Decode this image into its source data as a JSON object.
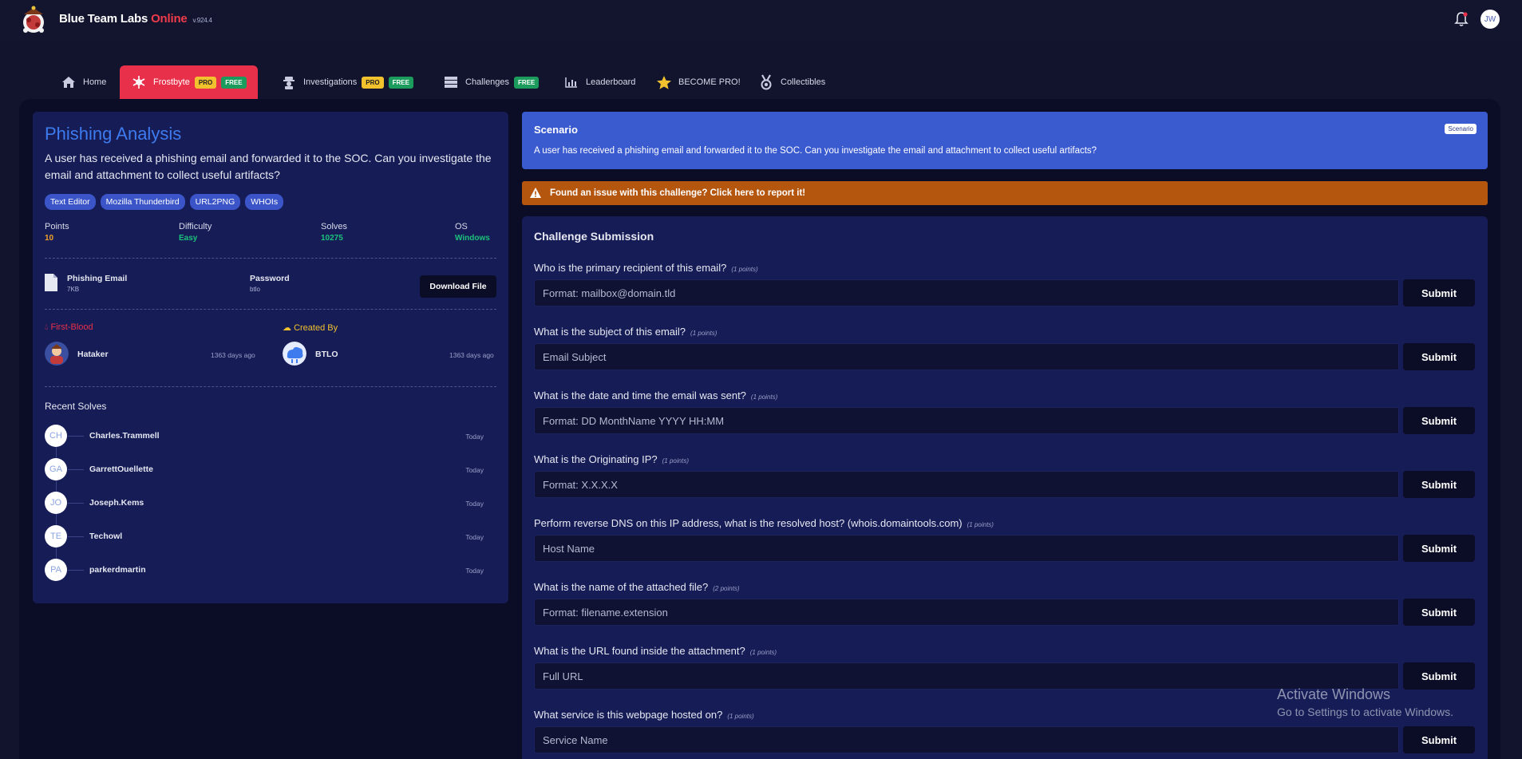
{
  "brand": {
    "name": "Blue Team Labs",
    "online": "Online",
    "version": "v.924.4"
  },
  "user": {
    "initials": "JW"
  },
  "nav": [
    {
      "label": "Home"
    },
    {
      "label": "Frostbyte",
      "pro": "PRO",
      "free": "FREE"
    },
    {
      "label": "Investigations",
      "pro": "PRO",
      "free": "FREE"
    },
    {
      "label": "Challenges",
      "free": "FREE"
    },
    {
      "label": "Leaderboard"
    },
    {
      "label": "BECOME PRO!"
    },
    {
      "label": "Collectibles"
    }
  ],
  "challenge": {
    "title": "Phishing Analysis",
    "description": "A user has received a phishing email and forwarded it to the SOC. Can you investigate the email and attachment to collect useful artifacts?",
    "tags": [
      "Text Editor",
      "Mozilla Thunderbird",
      "URL2PNG",
      "WHOIs"
    ],
    "stats": {
      "points_label": "Points",
      "points": "10",
      "difficulty_label": "Difficulty",
      "difficulty": "Easy",
      "solves_label": "Solves",
      "solves": "10275",
      "os_label": "OS",
      "os": "Windows"
    },
    "file": {
      "name": "Phishing Email",
      "size": "7KB",
      "password_label": "Password",
      "password": "btlo",
      "download_label": "Download File"
    },
    "first_blood": {
      "label": "First-Blood",
      "user": "Hataker",
      "ago": "1363 days ago"
    },
    "created_by": {
      "label": "Created By",
      "user": "BTLO",
      "ago": "1363 days ago"
    },
    "recent_solves_title": "Recent Solves",
    "recent_solves": [
      {
        "initials": "CH",
        "user": "Charles.Trammell",
        "when": "Today"
      },
      {
        "initials": "GA",
        "user": "GarrettOuellette",
        "when": "Today"
      },
      {
        "initials": "JO",
        "user": "Joseph.Kems",
        "when": "Today"
      },
      {
        "initials": "TE",
        "user": "Techowl",
        "when": "Today"
      },
      {
        "initials": "PA",
        "user": "parkerdmartin",
        "when": "Today"
      }
    ]
  },
  "scenario": {
    "title": "Scenario",
    "badge": "Scenario",
    "text": "A user has received a phishing email and forwarded it to the SOC. Can you investigate the email and attachment to collect useful artifacts?"
  },
  "report": {
    "text": "Found an issue with this challenge? Click here to report it!"
  },
  "submission": {
    "title": "Challenge Submission",
    "submit_label": "Submit",
    "questions": [
      {
        "question": "Who is the primary recipient of this email?",
        "points": "(1 points)",
        "placeholder": "Format: mailbox@domain.tld"
      },
      {
        "question": "What is the subject of this email?",
        "points": "(1 points)",
        "placeholder": "Email Subject"
      },
      {
        "question": "What is the date and time the email was sent?",
        "points": "(1 points)",
        "placeholder": "Format: DD MonthName YYYY HH:MM"
      },
      {
        "question": "What is the Originating IP?",
        "points": "(1 points)",
        "placeholder": "Format: X.X.X.X"
      },
      {
        "question": "Perform reverse DNS on this IP address, what is the resolved host? (whois.domaintools.com)",
        "points": "(1 points)",
        "placeholder": "Host Name"
      },
      {
        "question": "What is the name of the attached file?",
        "points": "(2 points)",
        "placeholder": "Format: filename.extension"
      },
      {
        "question": "What is the URL found inside the attachment?",
        "points": "(1 points)",
        "placeholder": "Full URL"
      },
      {
        "question": "What service is this webpage hosted on?",
        "points": "(1 points)",
        "placeholder": "Service Name"
      }
    ]
  },
  "watermark": {
    "line1": "Activate Windows",
    "line2": "Go to Settings to activate Windows."
  },
  "colors": {
    "accent_blue": "#3d7bef",
    "frostbyte_red": "#e8304a",
    "panel": "#161c56",
    "scenario": "#3a5ad0",
    "report": "#b5560f",
    "easy_green": "#1bc27a",
    "points_orange": "#f0a02a"
  }
}
